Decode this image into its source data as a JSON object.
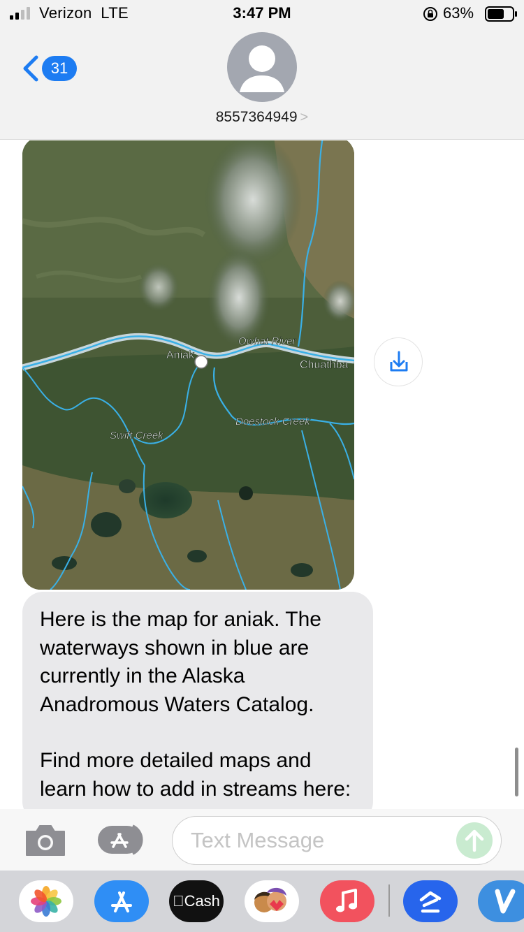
{
  "status_bar": {
    "carrier": "Verizon  LTE",
    "time": "3:47 PM",
    "battery_percent": "63%"
  },
  "header": {
    "back_count": "31",
    "contact": "8557364949"
  },
  "map": {
    "labels": {
      "owhat_river": "Owhat River",
      "aniak": "Aniak",
      "chuathba": "Chuathba",
      "doestock_creek": "Doestock Creek",
      "swift_creek": "Swift Creek"
    }
  },
  "message": {
    "paragraph_1": "Here is the map for aniak. The waterways shown in blue are currently in the Alaska Anadromous Waters Catalog.",
    "paragraph_2": "Find more detailed maps and learn how to add in streams here:"
  },
  "input": {
    "placeholder": "Text Message"
  },
  "app_drawer": {
    "apps": [
      "photos-icon",
      "appstore-icon",
      "apple-cash-icon",
      "memoji-icon",
      "music-icon",
      "zillow-icon",
      "venmo-icon"
    ],
    "cash_label": "Cash"
  },
  "colors": {
    "accent": "#1d7cf2",
    "bubble_gray": "#e9e9eb",
    "send_disabled": "#c9ebd0",
    "waterway": "#3ab0e6"
  }
}
